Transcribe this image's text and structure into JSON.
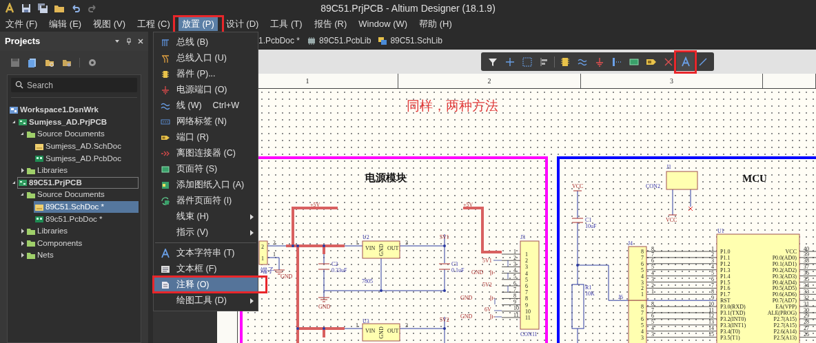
{
  "title_bar": {
    "title": "89C51.PrjPCB - Altium Designer (18.1.9)"
  },
  "menu_bar": [
    {
      "label": "文件 (F)",
      "selected": false
    },
    {
      "label": "编辑 (E)",
      "selected": false
    },
    {
      "label": "视图 (V)",
      "selected": false
    },
    {
      "label": "工程 (C)",
      "selected": false
    },
    {
      "label": "放置 (P)",
      "selected": true
    },
    {
      "label": "设计 (D)",
      "selected": false
    },
    {
      "label": "工具 (T)",
      "selected": false
    },
    {
      "label": "报告 (R)",
      "selected": false
    },
    {
      "label": "Window (W)",
      "selected": false
    },
    {
      "label": "帮助 (H)",
      "selected": false
    }
  ],
  "projects_panel": {
    "title": "Projects",
    "search": {
      "placeholder": "Search"
    },
    "tree": [
      {
        "label": "Workspace1.DsnWrk",
        "kind": "workspace",
        "selected": false,
        "focused": false,
        "children": [
          {
            "label": "Sumjess_AD.PrjPCB",
            "kind": "project",
            "expanded": true,
            "selected": false,
            "focused": false,
            "children": [
              {
                "label": "Source Documents",
                "kind": "folder",
                "expanded": true,
                "selected": false,
                "focused": false,
                "children": [
                  {
                    "label": "Sumjess_AD.SchDoc",
                    "kind": "schdoc",
                    "selected": false,
                    "focused": false
                  },
                  {
                    "label": "Sumjess_AD.PcbDoc",
                    "kind": "pcbdoc",
                    "selected": false,
                    "focused": false
                  }
                ]
              },
              {
                "label": "Libraries",
                "kind": "folder",
                "expanded": false,
                "selected": false,
                "focused": false
              }
            ]
          },
          {
            "label": "89C51.PrjPCB",
            "kind": "project",
            "expanded": true,
            "selected": false,
            "focused": true,
            "children": [
              {
                "label": "Source Documents",
                "kind": "folder",
                "expanded": true,
                "selected": false,
                "focused": false,
                "children": [
                  {
                    "label": "89C51.SchDoc *",
                    "kind": "schdoc",
                    "selected": true,
                    "focused": false
                  },
                  {
                    "label": "89c51.PcbDoc *",
                    "kind": "pcbdoc",
                    "selected": false,
                    "focused": false
                  }
                ]
              },
              {
                "label": "Libraries",
                "kind": "folder",
                "expanded": false,
                "selected": false,
                "focused": false
              },
              {
                "label": "Components",
                "kind": "folder",
                "expanded": false,
                "selected": false,
                "focused": false
              },
              {
                "label": "Nets",
                "kind": "folder",
                "expanded": false,
                "selected": false,
                "focused": false
              }
            ]
          }
        ]
      }
    ]
  },
  "document_tabs": [
    {
      "label": "1.PcbDoc *"
    },
    {
      "label": "89C51.PcbLib",
      "kind": "pcblib"
    },
    {
      "label": "89C51.SchLib",
      "kind": "schlib"
    }
  ],
  "place_menu": {
    "groups": [
      [
        {
          "label": "总线 (B)",
          "kind": "bus",
          "submenu": false,
          "selected": false
        },
        {
          "label": "总线入口 (U)",
          "kind": "bus-entry",
          "submenu": false,
          "selected": false
        },
        {
          "label": "器件 (P)...",
          "kind": "part",
          "submenu": false,
          "selected": false
        },
        {
          "label": "电源端口 (O)",
          "kind": "power",
          "submenu": false,
          "selected": false
        },
        {
          "label": "线 (W)",
          "shortcut": "Ctrl+W",
          "kind": "wire",
          "submenu": false,
          "selected": false
        },
        {
          "label": "网络标签 (N)",
          "kind": "net-label",
          "submenu": false,
          "selected": false
        },
        {
          "label": "端口 (R)",
          "kind": "port",
          "submenu": false,
          "selected": false
        },
        {
          "label": "离图连接器 (C)",
          "kind": "off-sheet",
          "submenu": false,
          "selected": false
        },
        {
          "label": "页面符 (S)",
          "kind": "sheet-symbol",
          "submenu": false,
          "selected": false
        },
        {
          "label": "添加图纸入口 (A)",
          "kind": "sheet-entry",
          "submenu": false,
          "selected": false
        },
        {
          "label": "器件页面符 (I)",
          "kind": "device-sheet",
          "submenu": false,
          "selected": false
        },
        {
          "label": "线束 (H)",
          "kind": "none",
          "submenu": true,
          "selected": false
        },
        {
          "label": "指示 (V)",
          "kind": "none",
          "submenu": true,
          "selected": false
        }
      ],
      [
        {
          "label": "文本字符串 (T)",
          "kind": "text",
          "submenu": false,
          "selected": false
        },
        {
          "label": "文本框 (F)",
          "kind": "text-frame",
          "submenu": false,
          "selected": false
        },
        {
          "label": "注释 (O)",
          "kind": "note",
          "submenu": false,
          "selected": true
        },
        {
          "label": "绘图工具 (D)",
          "kind": "none",
          "submenu": true,
          "selected": false
        }
      ]
    ]
  },
  "toolbar": [
    {
      "kind": "filter",
      "selected": false
    },
    {
      "kind": "cross",
      "selected": false
    },
    {
      "kind": "select",
      "selected": false
    },
    {
      "kind": "align",
      "selected": false
    },
    {
      "kind": "part",
      "selected": false
    },
    {
      "kind": "wire",
      "selected": false
    },
    {
      "kind": "power",
      "selected": false
    },
    {
      "kind": "bus",
      "selected": false
    },
    {
      "kind": "sheet-symbol",
      "selected": false
    },
    {
      "kind": "port",
      "selected": false
    },
    {
      "kind": "no-erc",
      "selected": false
    },
    {
      "kind": "text",
      "selected": true
    },
    {
      "kind": "line",
      "selected": false
    }
  ],
  "ruler": [
    "1",
    "2",
    "3"
  ],
  "schematic": {
    "note": "同样，两种方法",
    "modules": [
      {
        "kind": "power",
        "title": "电源模块",
        "labels": [
          {
            "text": "+5V",
            "kind": "net"
          },
          {
            "text": "+5V",
            "kind": "net"
          },
          {
            "text": "2",
            "kind": "pin"
          },
          {
            "text": "1",
            "kind": "pin"
          },
          {
            "text": "2",
            "kind": "pin"
          },
          {
            "text": "1",
            "kind": "pin"
          },
          {
            "text": "端子",
            "kind": "ref"
          },
          {
            "text": "GND",
            "kind": "net"
          },
          {
            "text": "U2",
            "kind": "ref"
          },
          {
            "text": "1",
            "kind": "pin"
          },
          {
            "text": "3",
            "kind": "pin"
          },
          {
            "text": "C2",
            "kind": "ref"
          },
          {
            "text": "0.33uF",
            "kind": "value"
          },
          {
            "text": "7805",
            "kind": "value"
          },
          {
            "text": "GND",
            "kind": "net"
          },
          {
            "text": "5V1",
            "kind": "net"
          },
          {
            "text": "C3",
            "kind": "ref"
          },
          {
            "text": "0.1uF",
            "kind": "value"
          },
          {
            "text": "U3",
            "kind": "ref"
          },
          {
            "text": "1",
            "kind": "pin"
          },
          {
            "text": "3",
            "kind": "pin"
          },
          {
            "text": "5V2",
            "kind": "net"
          },
          {
            "text": "J3",
            "kind": "ref"
          },
          {
            "text": "CON11",
            "kind": "value"
          },
          {
            "text": "5V1",
            "kind": "net"
          },
          {
            "text": "GND",
            "kind": "net"
          },
          {
            "text": "5V2",
            "kind": "net"
          },
          {
            "text": "GND",
            "kind": "net"
          },
          {
            "text": "6V",
            "kind": "net"
          },
          {
            "text": "GND",
            "kind": "net"
          },
          {
            "text": "VIN",
            "kind": "part"
          },
          {
            "text": "GND",
            "kind": "part-vertical"
          },
          {
            "text": "OUT",
            "kind": "part"
          },
          {
            "text": "VIN",
            "kind": "part"
          },
          {
            "text": "GND",
            "kind": "part-vertical"
          },
          {
            "text": "OUT",
            "kind": "part"
          }
        ],
        "connectors": [
          {
            "inner": [
              "1",
              "2",
              "3",
              "4",
              "5",
              "6",
              "7",
              "8",
              "9",
              "10",
              "11"
            ],
            "outer": [
              "1",
              "2",
              "3",
              "4",
              "5",
              "6",
              "7",
              "8",
              "9",
              "10",
              "11"
            ]
          }
        ]
      },
      {
        "kind": "mcu",
        "title": "MCU",
        "labels": [
          {
            "text": "VCC",
            "kind": "net"
          },
          {
            "text": "C1",
            "kind": "ref"
          },
          {
            "text": "10uF",
            "kind": "value"
          },
          {
            "text": "R1",
            "kind": "ref"
          },
          {
            "text": "10K",
            "kind": "value"
          },
          {
            "text": "J1",
            "kind": "ref"
          },
          {
            "text": "CON2",
            "kind": "value"
          },
          {
            "text": "VCC",
            "kind": "net"
          },
          {
            "text": "U1",
            "kind": "ref"
          },
          {
            "text": "J4",
            "kind": "ref"
          },
          {
            "text": "J6",
            "kind": "ref"
          }
        ],
        "connectors": [
          {
            "inner": [
              "8",
              "7",
              "6",
              "5",
              "4",
              "3",
              "2",
              "1"
            ],
            "outer": [
              "8",
              "7",
              "6",
              "5",
              "4",
              "3",
              "2",
              "1"
            ]
          },
          {
            "inner": [
              "8",
              "7",
              "6",
              "5",
              "4",
              "3"
            ],
            "outer": [
              "8",
              "7",
              "6",
              "5",
              "4",
              "3"
            ]
          }
        ],
        "chip": {
          "left_pins": [
            {
              "number": "1",
              "name": "P1.0"
            },
            {
              "number": "2",
              "name": "P1.1"
            },
            {
              "number": "3",
              "name": "P1.2"
            },
            {
              "number": "4",
              "name": "P1.3"
            },
            {
              "number": "5",
              "name": "P1.4"
            },
            {
              "number": "6",
              "name": "P1.5"
            },
            {
              "number": "7",
              "name": "P1.6"
            },
            {
              "number": "8",
              "name": "P1.7"
            },
            {
              "number": "9",
              "name": "RST"
            },
            {
              "number": "10",
              "name": "P3.0(RXD)"
            },
            {
              "number": "11",
              "name": "P3.1(TXD)"
            },
            {
              "number": "12",
              "name": "P3.2(INT0)"
            },
            {
              "number": "13",
              "name": "P3.3(INT1)"
            },
            {
              "number": "14",
              "name": "P3.4(T0)"
            },
            {
              "number": "15",
              "name": "P3.5(T1)"
            }
          ],
          "right_pins": [
            {
              "number": "40",
              "name": "VCC"
            },
            {
              "number": "39",
              "name": "P0.0(AD0)"
            },
            {
              "number": "38",
              "name": "P0.1(AD1)"
            },
            {
              "number": "37",
              "name": "P0.2(AD2)"
            },
            {
              "number": "36",
              "name": "P0.3(AD3)"
            },
            {
              "number": "35",
              "name": "P0.4(AD4)"
            },
            {
              "number": "34",
              "name": "P0.5(AD5)"
            },
            {
              "number": "33",
              "name": "P0.6(AD6)"
            },
            {
              "number": "32",
              "name": "P0.7(AD7)"
            },
            {
              "number": "31",
              "name": "EA(VPP)"
            },
            {
              "number": "30",
              "name": "ALE(PROG)"
            },
            {
              "number": "29",
              "name": "P2.7(A15)"
            },
            {
              "number": "28",
              "name": "P2.7(A15)"
            },
            {
              "number": "27",
              "name": "P2.6(A14)"
            },
            {
              "number": "26",
              "name": "P2.5(A13)"
            }
          ]
        }
      }
    ]
  }
}
